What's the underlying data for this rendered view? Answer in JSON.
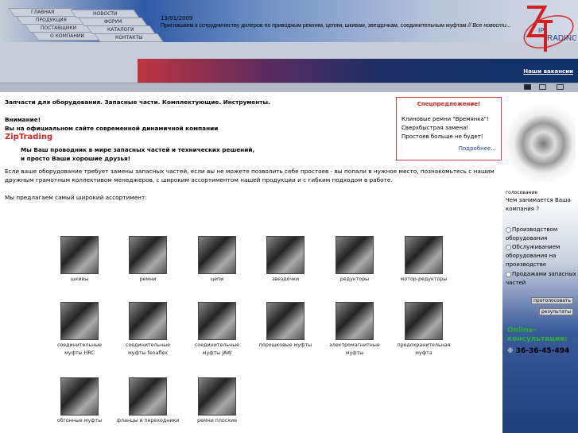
{
  "nav": {
    "left": [
      "ГЛАВНАЯ",
      "ПРОДУКЦИЯ",
      "ПОСТАВЩИКИ",
      "О КОМПАНИИ"
    ],
    "right": [
      "НОВОСТИ",
      "ФОРУМ",
      "КАТАЛОГИ",
      "КОНТАКТЫ"
    ]
  },
  "news": {
    "date": "13/01/2009",
    "text": "Приглашаем к сотрудничеству дилеров по приводным ремням, цепям, шкивам, звездочкам, соединительным муфтам",
    "all": "// Все новости..."
  },
  "logo": {
    "text": "ZIP TRADING"
  },
  "vacancies": "Наши вакансии",
  "main": {
    "line1": "Запчасти для оборудования. Запасные части. Комплектующие. Инструменты.",
    "attention": "Внимание!",
    "official": "Вы на официальном сайте современной динамичной компании",
    "brand": "ZipTrading",
    "slogan1": "Мы Ваш проводник в мире запасных частей и технических решений,",
    "slogan2": "и просто Ваши хорошие друзья!",
    "para": "Если ваше оборудование требует замены запасных частей, если вы не можете позволить себе простоев - вы попали в нужное место, познакомьтесь с нашим дружным грамотным коллективом менеджеров, с широким ассортиментом нашей продукции и с гибким подходом в работе.",
    "offer": "Мы предлагаем самый широкий ассортимент:"
  },
  "promo": {
    "title": "Спецпредложение!",
    "l1": "Клиновые ремни \"Времянка\"!",
    "l2": "Сверхбыстрая замена!",
    "l3": "Простоев больше не будет!",
    "more": "Подробнее..."
  },
  "products": [
    {
      "label": "шкивы"
    },
    {
      "label": "ремни"
    },
    {
      "label": "цепи"
    },
    {
      "label": "звездочки"
    },
    {
      "label": "редукторы"
    },
    {
      "label": "мотор-редукторы"
    },
    {
      "label": "соединительные муфты HRC"
    },
    {
      "label": "соединительные муфты fenaflex"
    },
    {
      "label": "соединительные муфты JAW"
    },
    {
      "label": "порошковые муфты"
    },
    {
      "label": "электромагнитные муфты"
    },
    {
      "label": "предохранительная муфта"
    },
    {
      "label": "обгонные муфты"
    },
    {
      "label": "фланцы и переходники"
    },
    {
      "label": "ремни плоские"
    }
  ],
  "poll": {
    "heading": "голосование",
    "question": "Чем занимается Ваша компания ?",
    "options": [
      "Производством оборудования",
      "Обслуживанием оборудования на производстве",
      "Продажами запасных частей"
    ],
    "vote": "проголосовать",
    "results": "результаты"
  },
  "online": "Online-консультация:",
  "phone": "36-36-45-494"
}
